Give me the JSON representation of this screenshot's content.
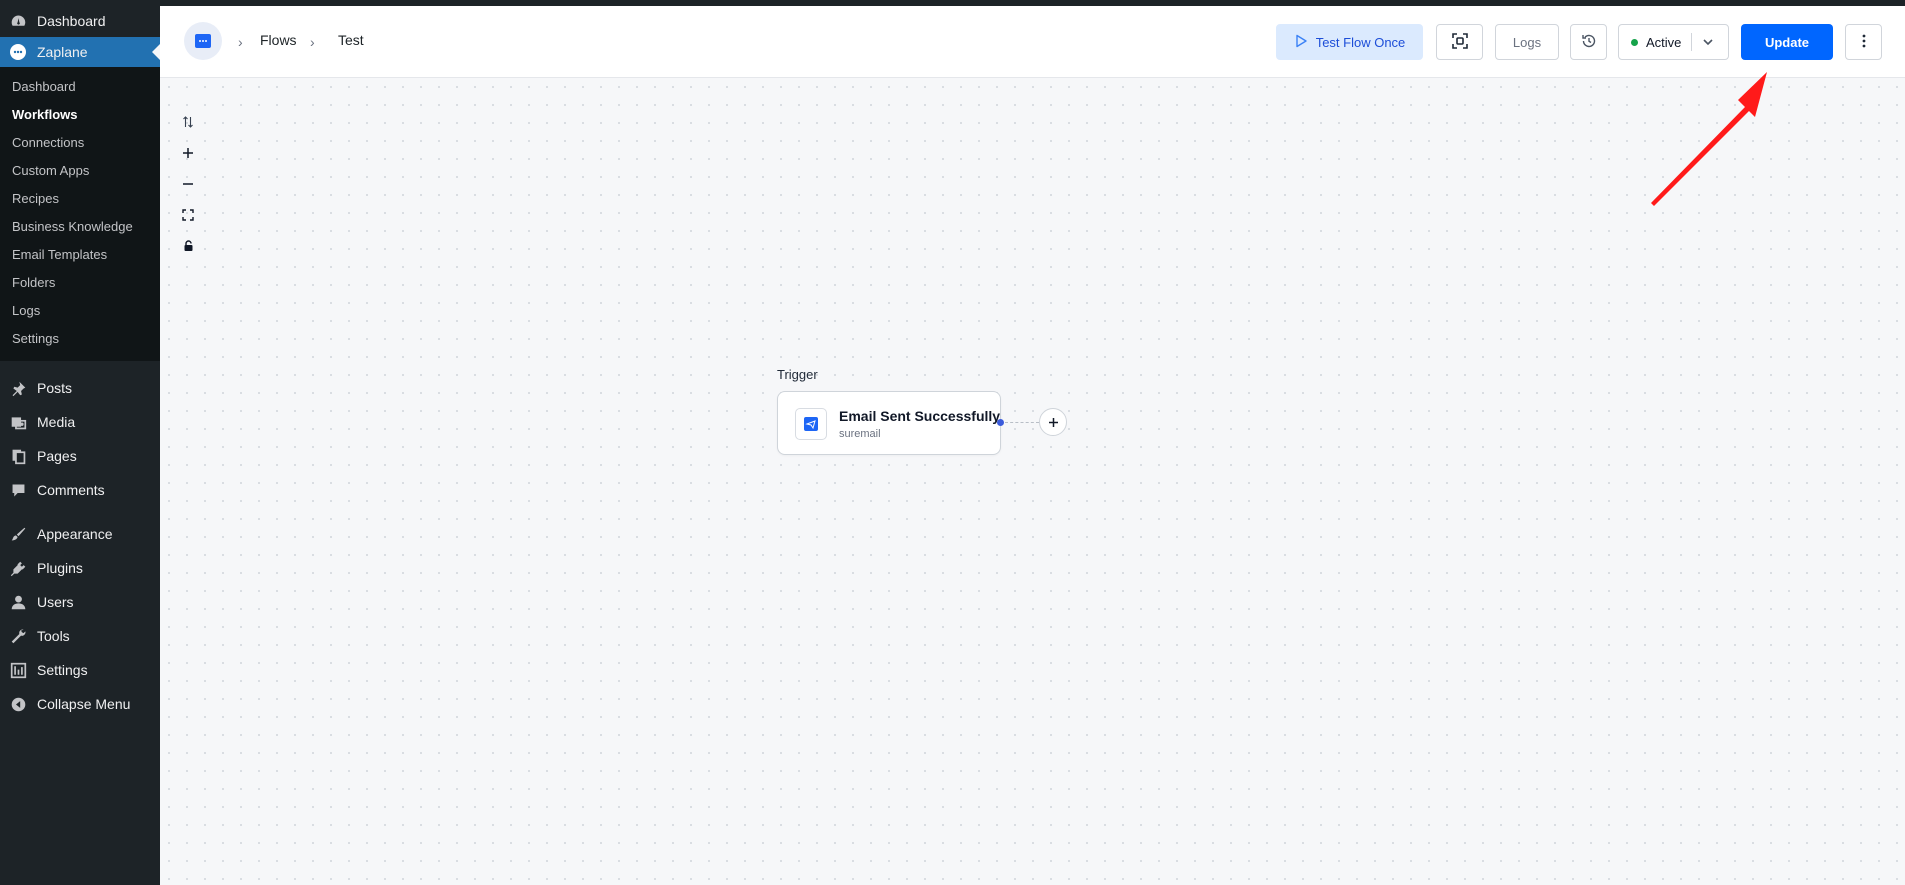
{
  "sidebar": {
    "top_items": [
      {
        "label": "Dashboard",
        "icon": "gauge-icon"
      },
      {
        "label": "Zaplane",
        "icon": "zaplane-icon"
      }
    ],
    "zaplane_submenu": [
      "Dashboard",
      "Workflows",
      "Connections",
      "Custom Apps",
      "Recipes",
      "Business Knowledge",
      "Email Templates",
      "Folders",
      "Logs",
      "Settings"
    ],
    "group_a": [
      {
        "label": "Posts",
        "icon": "pin-icon"
      },
      {
        "label": "Media",
        "icon": "media-icon"
      },
      {
        "label": "Pages",
        "icon": "pages-icon"
      },
      {
        "label": "Comments",
        "icon": "comment-icon"
      }
    ],
    "group_b": [
      {
        "label": "Appearance",
        "icon": "brush-icon"
      },
      {
        "label": "Plugins",
        "icon": "plug-icon"
      },
      {
        "label": "Users",
        "icon": "user-icon"
      },
      {
        "label": "Tools",
        "icon": "wrench-icon"
      },
      {
        "label": "Settings",
        "icon": "sliders-icon"
      },
      {
        "label": "Collapse Menu",
        "icon": "collapse-icon"
      }
    ]
  },
  "header": {
    "breadcrumb": [
      "Flows",
      "Test"
    ],
    "test_flow_label": "Test Flow Once",
    "logs_label": "Logs",
    "status_label": "Active",
    "update_label": "Update"
  },
  "canvas": {
    "trigger_label": "Trigger",
    "node": {
      "title": "Email Sent Successfully",
      "app": "suremail"
    }
  },
  "colors": {
    "sidebar_bg": "#1d2327",
    "sidebar_active": "#2271b1",
    "primary": "#0066ff",
    "status_active": "#16a34a",
    "annotation_arrow": "#ff1a1a"
  }
}
